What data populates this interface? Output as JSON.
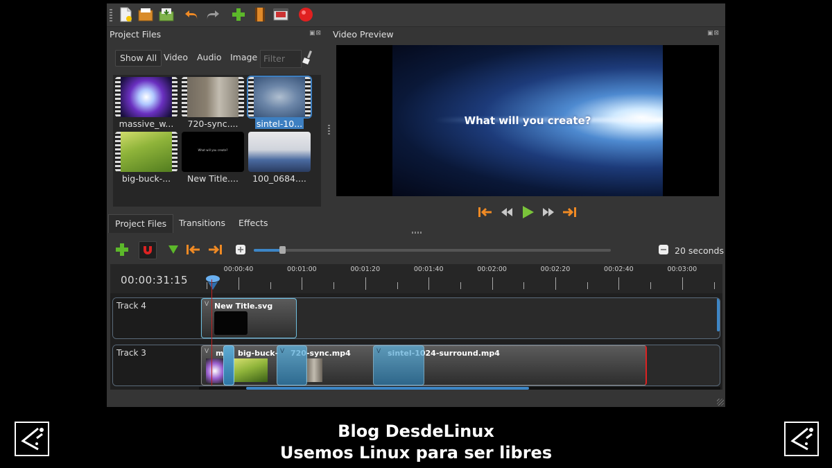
{
  "toolbar": {
    "buttons": [
      "new-project-icon",
      "open-project-icon",
      "save-project-icon",
      "undo-icon",
      "redo-icon",
      "import-files-icon",
      "choose-profile-icon",
      "export-icon",
      "record-icon"
    ]
  },
  "project_files": {
    "title": "Project Files",
    "filters": [
      "Show All",
      "Video",
      "Audio",
      "Image"
    ],
    "filter_placeholder": "Filter",
    "files": [
      {
        "name": "massive_w...",
        "selected": false
      },
      {
        "name": "720-sync....",
        "selected": false
      },
      {
        "name": "sintel-10...",
        "selected": true
      },
      {
        "name": "big-buck-...",
        "selected": false
      },
      {
        "name": "New Title....",
        "selected": false
      },
      {
        "name": "100_0684....",
        "selected": false
      }
    ],
    "title_thumb_text": "What will you create?"
  },
  "bottom_tabs": [
    "Project Files",
    "Transitions",
    "Effects"
  ],
  "preview": {
    "title": "Video Preview",
    "overlay_text": "What will you create?"
  },
  "timeline": {
    "current_time": "00:00:31:15",
    "zoom_label": "20 seconds",
    "zoom_fraction": 0.08,
    "ticks": [
      "00:00:40",
      "00:01:00",
      "00:01:20",
      "00:01:40",
      "00:02:00",
      "00:02:20",
      "00:02:40",
      "00:03:00"
    ],
    "tracks": [
      {
        "name": "Track 4",
        "clips": [
          {
            "name": "New Title.svg"
          }
        ]
      },
      {
        "name": "Track 3",
        "clips": [
          {
            "name": "m"
          },
          {
            "name": "big-buck-"
          },
          {
            "name": "720-sync.mp4"
          },
          {
            "name": "sintel-1024-surround.mp4"
          }
        ]
      }
    ]
  },
  "footer": {
    "line1": "Blog DesdeLinux",
    "line2": "Usemos Linux para ser libres"
  },
  "colors": {
    "accent": "#3d86c6",
    "record": "#e02020",
    "orange": "#f08a24",
    "green": "#5cb82a"
  }
}
